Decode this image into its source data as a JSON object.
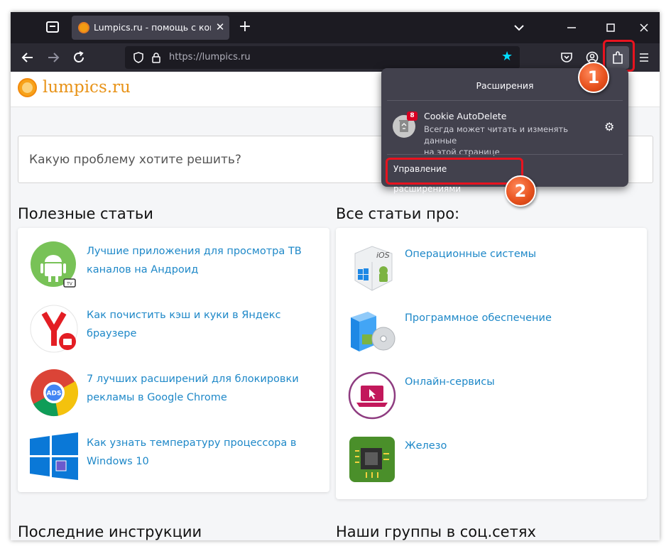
{
  "browser": {
    "tab_title": "Lumpics.ru - помощь с компь",
    "url": "https://lumpics.ru"
  },
  "site": {
    "logo_text": "lumpics.ru",
    "search_placeholder": "Какую проблему хотите решить?",
    "useful_title": "Полезные статьи",
    "all_title": "Все статьи про:",
    "latest_title": "Последние инструкции",
    "groups_title": "Наши группы в соц.сетях",
    "useful": [
      {
        "line1": "Лучшие приложения для просмотра ТВ",
        "line2": "каналов на Андроид",
        "icon": "android-tv-icon"
      },
      {
        "line1": "Как почистить кэш и куки в Яндекс",
        "line2": "браузере",
        "icon": "yandex-browser-icon"
      },
      {
        "line1": "7 лучших расширений для блокировки",
        "line2": "рекламы в Google Chrome",
        "icon": "chrome-ads-icon"
      },
      {
        "line1": "Как узнать температуру процессора в",
        "line2": "Windows 10",
        "icon": "windows-10-icon"
      }
    ],
    "categories": [
      {
        "label": "Операционные системы",
        "icon": "os-box-icon"
      },
      {
        "label": "Программное обеспечение",
        "icon": "software-box-icon"
      },
      {
        "label": "Онлайн-сервисы",
        "icon": "online-services-icon"
      },
      {
        "label": "Железо",
        "icon": "hardware-chip-icon"
      }
    ]
  },
  "extensions_panel": {
    "title": "Расширения",
    "extension_name": "Cookie AutoDelete",
    "extension_badge": "8",
    "extension_desc_1": "Всегда может читать и изменять данные",
    "extension_desc_2": "на этой странице",
    "manage_label": "Управление расширениями"
  },
  "annotations": {
    "step1": "1",
    "step2": "2"
  },
  "colors": {
    "highlight": "#e8131f",
    "link": "#1e88c8",
    "accent_star": "#00ddff"
  }
}
